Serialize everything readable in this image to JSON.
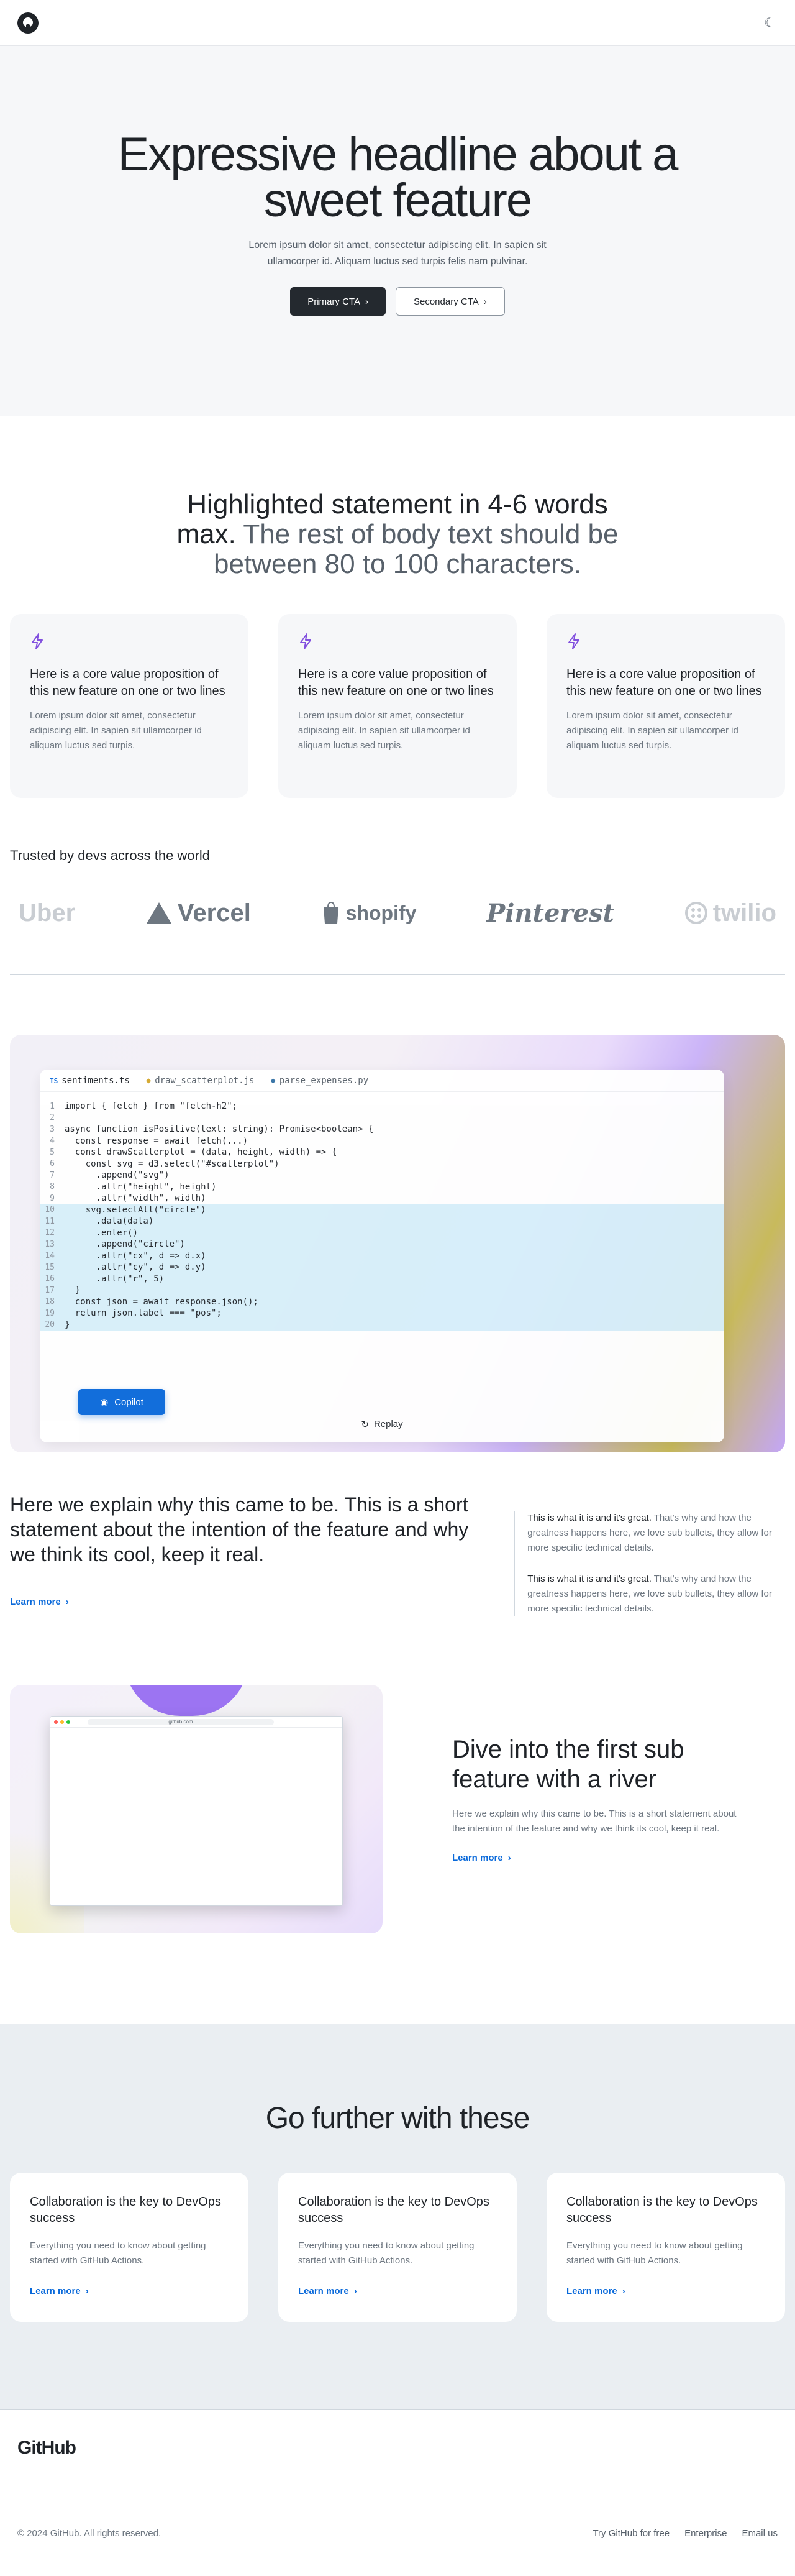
{
  "nav": {
    "theme_toggle": "☾"
  },
  "hero": {
    "title": "Expressive headline about a sweet feature",
    "body": "Lorem ipsum dolor sit amet, consectetur adipiscing elit. In sapien sit ullamcorper id. Aliquam luctus sed turpis felis nam pulvinar.",
    "primary_cta": "Primary CTA",
    "secondary_cta": "Secondary CTA"
  },
  "statement": {
    "highlight": "Highlighted statement in 4-6 words max.",
    "rest": "The rest of body text should be between 80 to 100 characters."
  },
  "pillars": [
    {
      "icon": "zap-icon",
      "title": "Here is a core value proposition of this new feature on one or two lines",
      "body": "Lorem ipsum dolor sit amet, consectetur adipiscing elit. In sapien sit ullamcorper id aliquam luctus sed turpis."
    },
    {
      "icon": "zap-icon",
      "title": "Here is a core value proposition of this new feature on one or two lines",
      "body": "Lorem ipsum dolor sit amet, consectetur adipiscing elit. In sapien sit ullamcorper id aliquam luctus sed turpis."
    },
    {
      "icon": "zap-icon",
      "title": "Here is a core value proposition of this new feature on one or two lines",
      "body": "Lorem ipsum dolor sit amet, consectetur adipiscing elit. In sapien sit ullamcorper id aliquam luctus sed turpis."
    }
  ],
  "trusted": {
    "heading": "Trusted by devs across the world",
    "logos": [
      "Uber",
      "Vercel",
      "shopify",
      "Pinterest",
      "twilio"
    ]
  },
  "code": {
    "tabs": [
      "sentiments.ts",
      "draw_scatterplot.js",
      "parse_expenses.py"
    ],
    "lines": [
      "import { fetch } from \"fetch-h2\";",
      "",
      "async function isPositive(text: string): Promise<boolean> {",
      "  const response = await fetch(...)",
      "  const drawScatterplot = (data, height, width) => {",
      "    const svg = d3.select(\"#scatterplot\")",
      "      .append(\"svg\")",
      "      .attr(\"height\", height)",
      "      .attr(\"width\", width)",
      "    svg.selectAll(\"circle\")",
      "      .data(data)",
      "      .enter()",
      "      .append(\"circle\")",
      "      .attr(\"cx\", d => d.x)",
      "      .attr(\"cy\", d => d.y)",
      "      .attr(\"r\", 5)",
      "  }",
      "  const json = await response.json();",
      "  return json.label === \"pos\";",
      "}"
    ],
    "highlight_from": 10,
    "highlight_to": 20,
    "copilot_label": "Copilot",
    "replay_label": "Replay"
  },
  "explain": {
    "heading": "Here we explain why this came to be. This is a short statement about the intention of the feature and why we think its cool, keep it real.",
    "learn_more": "Learn more",
    "bullets": [
      {
        "lead": "This is what it is and it's great.",
        "body": " That's why and how the greatness happens here, we love sub bullets, they allow for more specific technical details."
      },
      {
        "lead": "This is what it is and it's great.",
        "body": " That's why and how the greatness happens here, we love sub bullets, they allow for more specific technical details."
      }
    ]
  },
  "river": {
    "url": "github.com",
    "title": "Dive into the first sub feature with a river",
    "body": "Here we explain why this came to be. This is a short statement about the intention of the feature and why we think its cool, keep it real.",
    "learn_more": "Learn more"
  },
  "further": {
    "heading": "Go further with these",
    "cards": [
      {
        "title": "Collaboration is the key to DevOps success",
        "body": "Everything you need to know about getting started with GitHub Actions.",
        "link": "Learn more"
      },
      {
        "title": "Collaboration is the key to DevOps success",
        "body": "Everything you need to know about getting started with GitHub Actions.",
        "link": "Learn more"
      },
      {
        "title": "Collaboration is the key to DevOps success",
        "body": "Everything you need to know about getting started with GitHub Actions.",
        "link": "Learn more"
      }
    ]
  },
  "footer": {
    "logo": "GitHub",
    "copyright": "© 2024 GitHub. All rights reserved.",
    "links": [
      "Try GitHub for free",
      "Enterprise",
      "Email us"
    ]
  }
}
